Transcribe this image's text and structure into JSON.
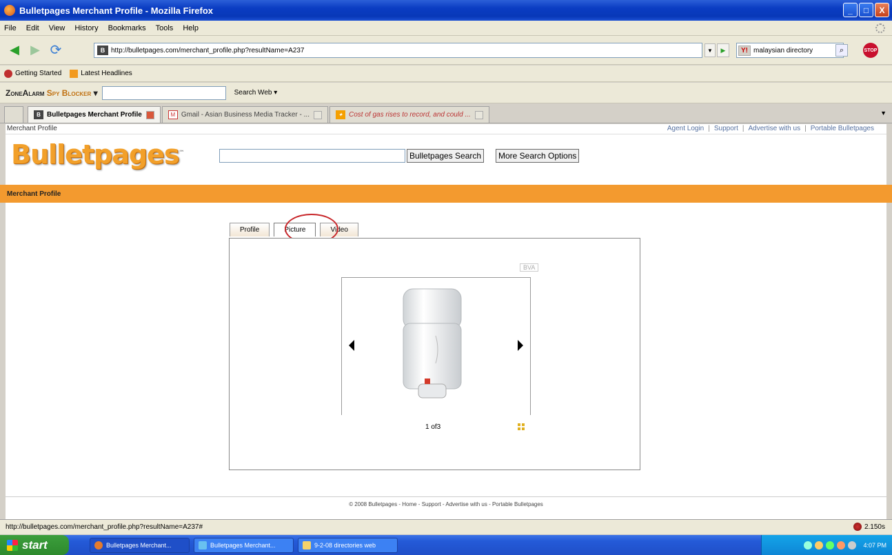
{
  "window": {
    "title": "Bulletpages Merchant Profile - Mozilla Firefox",
    "btn_min": "_",
    "btn_max": "□",
    "btn_close": "X"
  },
  "menu": [
    "File",
    "Edit",
    "View",
    "History",
    "Bookmarks",
    "Tools",
    "Help"
  ],
  "nav": {
    "url": "http://bulletpages.com/merchant_profile.php?resultName=A237",
    "search_value": "malaysian directory",
    "search_engine": "Y!",
    "stop_icon_label": "STOP"
  },
  "bookmarks": [
    "Getting Started",
    "Latest Headlines"
  ],
  "zonealarm": {
    "brand": "ZoneAlarm",
    "product": "Spy Blocker",
    "search_label": "Search Web"
  },
  "tabs": [
    {
      "label": "Bulletpages Merchant Profile",
      "active": true
    },
    {
      "label": "Gmail - Asian Business Media Tracker - ...",
      "active": false
    },
    {
      "label": "Cost of gas rises to record, and could ...",
      "active": false
    }
  ],
  "page": {
    "crumb": "Merchant Profile",
    "top_links": [
      "Agent Login",
      "Support",
      "Advertise with us",
      "Portable Bulletpages"
    ],
    "top_link_sep": "|",
    "logo": "Bulletpages",
    "logo_tm": "™",
    "search_button": "Bulletpages Search",
    "more_options_button": "More Search Options",
    "section_title": "Merchant Profile",
    "profile_tabs": [
      "Profile",
      "Picture",
      "Video"
    ],
    "active_tab": "Picture",
    "badge": "BVA",
    "counter": "1 of3",
    "footer": "© 2008 Bulletpages - Home - Support - Advertise with us - Portable Bulletpages"
  },
  "status": {
    "url": "http://bulletpages.com/merchant_profile.php?resultName=A237#",
    "time": "2.150s"
  },
  "taskbar": {
    "start": "start",
    "tasks": [
      "Bulletpages Merchant...",
      "Bulletpages Merchant...",
      "9-2-08 directories web"
    ],
    "clock": "4:07 PM"
  },
  "colors": {
    "accent_orange": "#f39a2f",
    "annotation_red": "#c8262a"
  }
}
